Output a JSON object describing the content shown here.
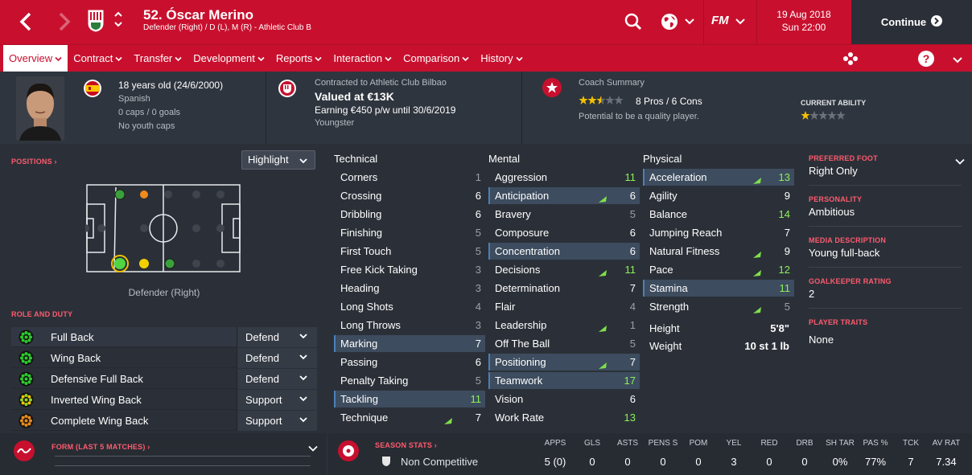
{
  "header": {
    "title": "52. Óscar Merino",
    "subtitle": "Defender (Right) / D (L), M (R) - Athletic Club B",
    "date": "19 Aug 2018",
    "time": "Sun 22:00",
    "continue_label": "Continue",
    "fm_label": "FM"
  },
  "nav": {
    "tabs": [
      "Overview",
      "Contract",
      "Transfer",
      "Development",
      "Reports",
      "Interaction",
      "Comparison",
      "History"
    ]
  },
  "profile": {
    "age": "18 years old (24/6/2000)",
    "nationality": "Spanish",
    "caps": "0 caps / 0 goals",
    "youth_caps": "No youth caps"
  },
  "contract": {
    "contracted_to": "Contracted to Athletic Club Bilbao",
    "value": "Valued at €13K",
    "earning": "Earning €450 p/w until 30/6/2019",
    "status": "Youngster"
  },
  "coach": {
    "title": "Coach Summary",
    "pros_cons": "8 Pros / 6 Cons",
    "potential": "Potential to be a quality player.",
    "current_ability_label": "CURRENT ABILITY",
    "stars": 2.5,
    "current_ability_stars": 1
  },
  "positions": {
    "label": "POSITIONS",
    "highlight_label": "Highlight",
    "position_name": "Defender (Right)"
  },
  "role_duty": {
    "label": "ROLE AND DUTY",
    "roles": [
      {
        "name": "Full Back",
        "duty": "Defend"
      },
      {
        "name": "Wing Back",
        "duty": "Defend"
      },
      {
        "name": "Defensive Full Back",
        "duty": "Defend"
      },
      {
        "name": "Inverted Wing Back",
        "duty": "Support"
      },
      {
        "name": "Complete Wing Back",
        "duty": "Support"
      }
    ]
  },
  "form": {
    "label": "FORM (LAST 5 MATCHES)"
  },
  "technical": {
    "title": "Technical",
    "attrs": [
      {
        "name": "Corners",
        "value": "1"
      },
      {
        "name": "Crossing",
        "value": "6"
      },
      {
        "name": "Dribbling",
        "value": "6"
      },
      {
        "name": "Finishing",
        "value": "5"
      },
      {
        "name": "First Touch",
        "value": "5"
      },
      {
        "name": "Free Kick Taking",
        "value": "3"
      },
      {
        "name": "Heading",
        "value": "3"
      },
      {
        "name": "Long Shots",
        "value": "4"
      },
      {
        "name": "Long Throws",
        "value": "3"
      },
      {
        "name": "Marking",
        "value": "7"
      },
      {
        "name": "Passing",
        "value": "6"
      },
      {
        "name": "Penalty Taking",
        "value": "5"
      },
      {
        "name": "Tackling",
        "value": "11"
      },
      {
        "name": "Technique",
        "value": "7"
      }
    ]
  },
  "mental": {
    "title": "Mental",
    "attrs": [
      {
        "name": "Aggression",
        "value": "11"
      },
      {
        "name": "Anticipation",
        "value": "6"
      },
      {
        "name": "Bravery",
        "value": "5"
      },
      {
        "name": "Composure",
        "value": "6"
      },
      {
        "name": "Concentration",
        "value": "6"
      },
      {
        "name": "Decisions",
        "value": "11"
      },
      {
        "name": "Determination",
        "value": "7"
      },
      {
        "name": "Flair",
        "value": "4"
      },
      {
        "name": "Leadership",
        "value": "1"
      },
      {
        "name": "Off The Ball",
        "value": "5"
      },
      {
        "name": "Positioning",
        "value": "7"
      },
      {
        "name": "Teamwork",
        "value": "17"
      },
      {
        "name": "Vision",
        "value": "6"
      },
      {
        "name": "Work Rate",
        "value": "13"
      }
    ]
  },
  "physical": {
    "title": "Physical",
    "attrs": [
      {
        "name": "Acceleration",
        "value": "13"
      },
      {
        "name": "Agility",
        "value": "9"
      },
      {
        "name": "Balance",
        "value": "14"
      },
      {
        "name": "Jumping Reach",
        "value": "7"
      },
      {
        "name": "Natural Fitness",
        "value": "9"
      },
      {
        "name": "Pace",
        "value": "12"
      },
      {
        "name": "Stamina",
        "value": "11"
      },
      {
        "name": "Strength",
        "value": "5"
      }
    ],
    "height_label": "Height",
    "height": "5'8\"",
    "weight_label": "Weight",
    "weight": "10 st 1 lb"
  },
  "sidebar": {
    "preferred_foot_label": "PREFERRED FOOT",
    "preferred_foot": "Right Only",
    "personality_label": "PERSONALITY",
    "personality": "Ambitious",
    "media_label": "MEDIA DESCRIPTION",
    "media": "Young full-back",
    "gk_label": "GOALKEEPER RATING",
    "gk": "2",
    "traits_label": "PLAYER TRAITS",
    "traits": "None"
  },
  "season_stats": {
    "label": "SEASON STATS",
    "competition": "Non Competitive",
    "headers": [
      "APPS",
      "GLS",
      "ASTS",
      "PENS S",
      "POM",
      "YEL",
      "RED",
      "DRB",
      "SH TAR",
      "PAS %",
      "TCK",
      "AV RAT"
    ],
    "values": [
      "5 (0)",
      "0",
      "0",
      "0",
      "0",
      "3",
      "0",
      "0",
      "0%",
      "77%",
      "7",
      "7.34"
    ]
  }
}
